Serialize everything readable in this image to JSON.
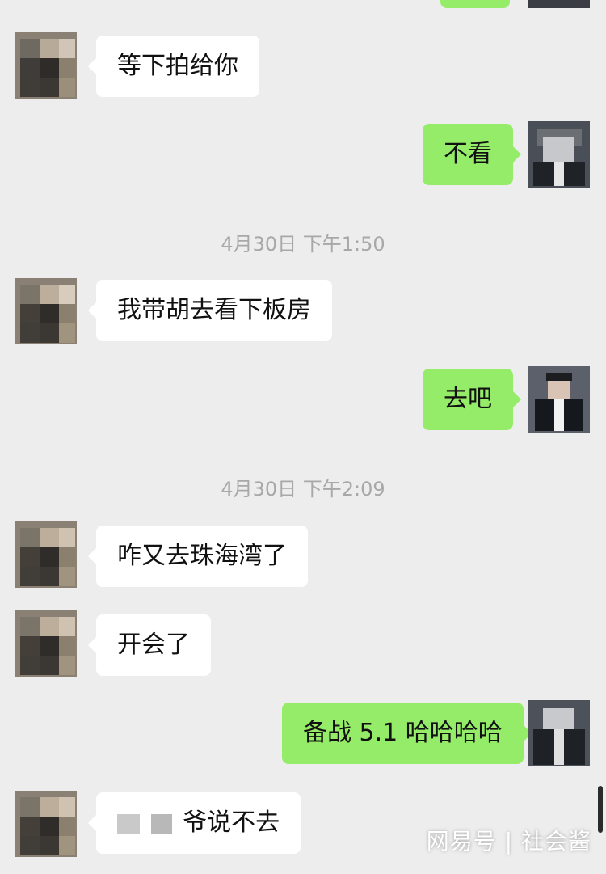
{
  "chat": {
    "messages": [
      {
        "id": "m1",
        "from": "contact",
        "text": "等下拍给你"
      },
      {
        "id": "m2",
        "from": "me",
        "text": "不看"
      },
      {
        "id": "t1",
        "type": "timestamp",
        "text": "4月30日 下午1:50"
      },
      {
        "id": "m3",
        "from": "contact",
        "text": "我带胡去看下板房"
      },
      {
        "id": "m4",
        "from": "me",
        "text": "去吧"
      },
      {
        "id": "t2",
        "type": "timestamp",
        "text": "4月30日 下午2:09"
      },
      {
        "id": "m5",
        "from": "contact",
        "text": "咋又去珠海湾了"
      },
      {
        "id": "m6",
        "from": "contact",
        "text": "开会了"
      },
      {
        "id": "m7",
        "from": "me",
        "text": "备战 5.1 哈哈哈哈"
      },
      {
        "id": "m8",
        "from": "contact",
        "text": "爷说不去"
      }
    ]
  },
  "watermark": {
    "text": "网易号 | 社会酱"
  },
  "colors": {
    "background": "#ededed",
    "incoming_bubble": "#ffffff",
    "outgoing_bubble": "#95ec69",
    "timestamp_text": "#a8a8a8"
  },
  "avatars": {
    "contact": "contact-avatar-pixelated",
    "me": "user-avatar-pixelated"
  }
}
